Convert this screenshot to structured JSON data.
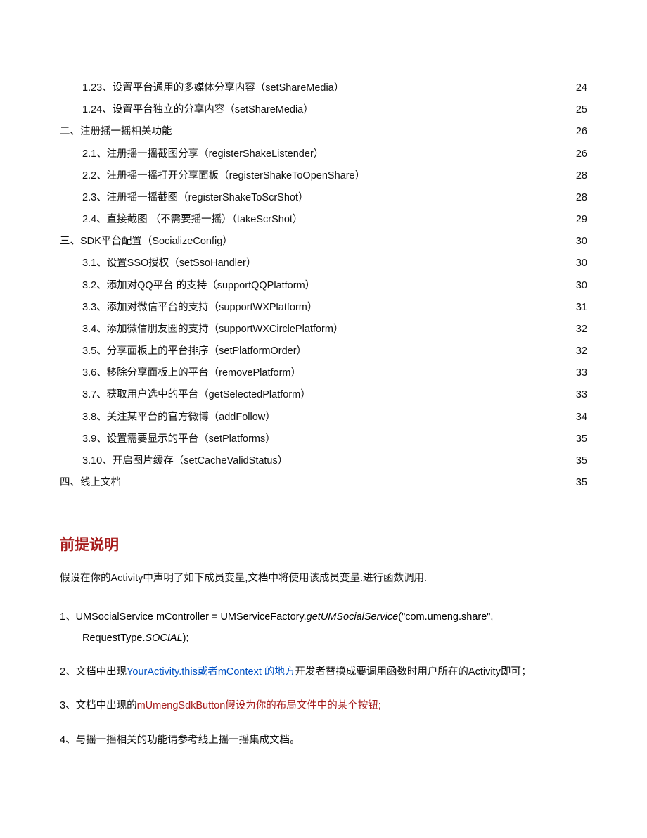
{
  "toc": [
    {
      "indent": 1,
      "label": "1.23、设置平台通用的多媒体分享内容（setShareMedia）",
      "page": "24"
    },
    {
      "indent": 1,
      "label": "1.24、设置平台独立的分享内容（setShareMedia）",
      "page": "25"
    },
    {
      "indent": 0,
      "label": "二、注册摇一摇相关功能",
      "page": "26"
    },
    {
      "indent": 1,
      "label": "2.1、注册摇一摇截图分享（registerShakeListender）",
      "page": "26"
    },
    {
      "indent": 1,
      "label": "2.2、注册摇一摇打开分享面板（registerShakeToOpenShare）",
      "page": "28"
    },
    {
      "indent": 1,
      "label": "2.3、注册摇一摇截图（registerShakeToScrShot）",
      "page": "28"
    },
    {
      "indent": 1,
      "label": "2.4、直接截图 （不需要摇一摇）（takeScrShot）",
      "page": "29"
    },
    {
      "indent": 0,
      "label": "三、SDK平台配置（SocializeConfig）",
      "page": "30"
    },
    {
      "indent": 1,
      "label": "3.1、设置SSO授权（setSsoHandler）",
      "page": "30"
    },
    {
      "indent": 1,
      "label": "3.2、添加对QQ平台 的支持（supportQQPlatform）",
      "page": "30"
    },
    {
      "indent": 1,
      "label": "3.3、添加对微信平台的支持（supportWXPlatform）",
      "page": "31"
    },
    {
      "indent": 1,
      "label": "3.4、添加微信朋友圈的支持（supportWXCirclePlatform）",
      "page": "32"
    },
    {
      "indent": 1,
      "label": "3.5、分享面板上的平台排序（setPlatformOrder）",
      "page": "32"
    },
    {
      "indent": 1,
      "label": "3.6、移除分享面板上的平台（removePlatform）",
      "page": "33"
    },
    {
      "indent": 1,
      "label": "3.7、获取用户选中的平台（getSelectedPlatform）",
      "page": "33"
    },
    {
      "indent": 1,
      "label": "3.8、关注某平台的官方微博（addFollow）",
      "page": "34"
    },
    {
      "indent": 1,
      "label": "3.9、设置需要显示的平台（setPlatforms）",
      "page": "35"
    },
    {
      "indent": 1,
      "label": "3.10、开启图片缓存（setCacheValidStatus）",
      "page": "35"
    },
    {
      "indent": 0,
      "label": "四、线上文档",
      "page": "35"
    }
  ],
  "prereq": {
    "heading": "前提说明",
    "intro": "假设在你的Activity中声明了如下成员变量,文档中将使用该成员变量.进行函数调用.",
    "item1": {
      "pre": "1、UMSocialService ",
      "mController": "mController ",
      "mid": "= UMServiceFactory.",
      "getFn": "getUMSocialService",
      "args": "(\"com.umeng.share\",",
      "line2_req": "RequestType.",
      "line2_social": "SOCIAL",
      "line2_end": ");"
    },
    "item2": {
      "pre": "2、文档中出现",
      "blue": "YourActivity.this或者mContext 的地方",
      "post": "开发者替换成要调用函数时用户所在的Activity即可；"
    },
    "item3": {
      "pre": "3、文档中出现的",
      "red": "mUmengSdkButton假设为你的布局文件中的某个按钮;"
    },
    "item4": "4、与摇一摇相关的功能请参考线上摇一摇集成文档。"
  }
}
